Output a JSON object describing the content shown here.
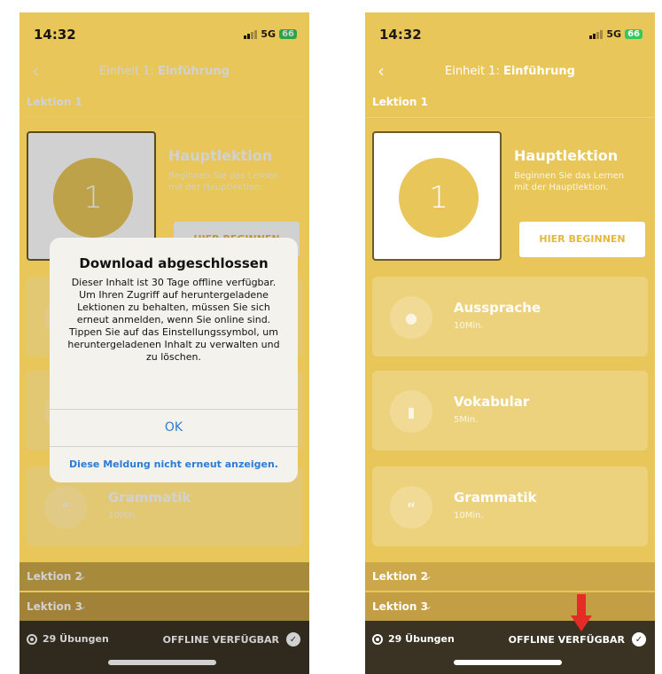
{
  "status": {
    "time": "14:32",
    "network": "5G",
    "battery": "66"
  },
  "nav": {
    "title_prefix": "Einheit 1: ",
    "title_bold": "Einführung",
    "back": "‹"
  },
  "lesson1": {
    "header": "Lektion 1",
    "number": "1",
    "title": "Hauptlektion",
    "subtitle": "Beginnen Sie das Lernen mit der Hauptlektion.",
    "start_button": "HIER BEGINNEN",
    "start_button_left_partial": "HIER BEGINNEN"
  },
  "cards": [
    {
      "title": "Aussprache",
      "duration": "10Min.",
      "icon": "microphone-icon"
    },
    {
      "title": "Vokabular",
      "duration": "5Min.",
      "icon": "book-icon"
    },
    {
      "title": "Grammatik",
      "duration": "10Min.",
      "icon": "quote-icon"
    }
  ],
  "lessons": [
    {
      "label": "Lektion 2"
    },
    {
      "label": "Lektion 3"
    }
  ],
  "bottom": {
    "exercises": "29 Übungen",
    "offline": "OFFLINE VERFÜGBAR"
  },
  "dialog": {
    "title": "Download abgeschlossen",
    "message": "Dieser Inhalt ist 30 Tage offline verfügbar. Um Ihren Zugriff auf heruntergeladene Lektionen zu behalten, müssen Sie sich erneut anmelden, wenn Sie online sind. Tippen Sie auf das Einstellungssymbol, um heruntergeladenen Inhalt zu verwalten und zu löschen.",
    "ok": "OK",
    "dont_show": "Diese Meldung nicht erneut anzeigen."
  },
  "colors": {
    "accent": "#e8c65a",
    "link": "#2a7cd6",
    "arrow": "#e52b25"
  }
}
